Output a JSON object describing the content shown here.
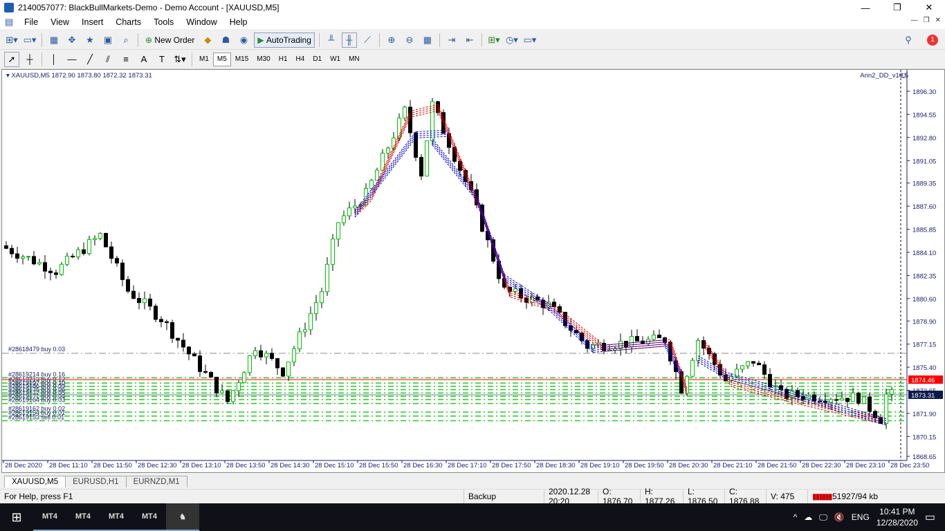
{
  "window": {
    "title": "2140057077: BlackBullMarkets-Demo - Demo Account - [XAUUSD,M5]",
    "minimize": "—",
    "maximize": "❐",
    "close": "✕"
  },
  "menu": [
    "File",
    "View",
    "Insert",
    "Charts",
    "Tools",
    "Window",
    "Help"
  ],
  "toolbar": {
    "new_order": "New Order",
    "autotrading": "AutoTrading",
    "notif_count": "1"
  },
  "timeframes": [
    "M1",
    "M5",
    "M15",
    "M30",
    "H1",
    "H4",
    "D1",
    "W1",
    "MN"
  ],
  "active_timeframe": "M5",
  "chart": {
    "symbol_info": "XAUUSD,M5  1872.90 1873.80 1872.32 1873.31",
    "ea_name": "Arin2_DD_v10.5",
    "price_ticks": [
      "1896.30",
      "1894.55",
      "1892.80",
      "1891.05",
      "1889.35",
      "1887.60",
      "1885.85",
      "1884.10",
      "1882.35",
      "1880.60",
      "1878.90",
      "1877.15",
      "1875.40",
      "1873.65",
      "1871.90",
      "1870.15",
      "1868.65"
    ],
    "price_range": [
      1868.65,
      1896.3
    ],
    "time_labels": [
      "28 Dec 2020",
      "28 Dec 11:10",
      "28 Dec 11:50",
      "28 Dec 12:30",
      "28 Dec 13:10",
      "28 Dec 13:50",
      "28 Dec 14:30",
      "28 Dec 15:10",
      "28 Dec 15:50",
      "28 Dec 16:30",
      "28 Dec 17:10",
      "28 Dec 17:50",
      "28 Dec 18:30",
      "28 Dec 19:10",
      "28 Dec 19:50",
      "28 Dec 20:30",
      "28 Dec 21:10",
      "28 Dec 21:50",
      "28 Dec 22:30",
      "28 Dec 23:10",
      "28 Dec 23:50"
    ],
    "ask_label": "1874.46",
    "bid_label": "1873.31",
    "ask": 1874.46,
    "bid": 1873.31,
    "price_waypoints": [
      [
        0,
        1884.6
      ],
      [
        10,
        1882.7
      ],
      [
        18,
        1885.4
      ],
      [
        23,
        1881.2
      ],
      [
        29,
        1879.1
      ],
      [
        35,
        1875.9
      ],
      [
        41,
        1872.8
      ],
      [
        46,
        1877.0
      ],
      [
        51,
        1875.1
      ],
      [
        58,
        1881.2
      ],
      [
        61,
        1886.4
      ],
      [
        66,
        1888.5
      ],
      [
        73,
        1894.8
      ],
      [
        76,
        1890.1
      ],
      [
        78,
        1895.3
      ],
      [
        85,
        1888.5
      ],
      [
        91,
        1881.2
      ],
      [
        99,
        1880.1
      ],
      [
        106,
        1877.0
      ],
      [
        120,
        1877.5
      ],
      [
        123,
        1873.8
      ],
      [
        126,
        1877.5
      ],
      [
        131,
        1874.4
      ],
      [
        136,
        1875.9
      ],
      [
        141,
        1873.3
      ],
      [
        155,
        1873.1
      ],
      [
        159,
        1871.5
      ],
      [
        160,
        1873.3
      ]
    ],
    "orders": [
      {
        "label": "#28618479 buy 0.03",
        "price": 1876.45
      },
      {
        "label": "#28619214 buy 0.16",
        "price": 1874.6
      },
      {
        "label": "#28619213 buy 0.12",
        "price": 1874.2
      },
      {
        "label": "#28619197 buy 0.10",
        "price": 1873.95
      },
      {
        "label": "#28619186 buy 0.09",
        "price": 1873.7
      },
      {
        "label": "#28619175 buy 0.06",
        "price": 1873.45
      },
      {
        "label": "#28619172 buy 0.05",
        "price": 1873.2
      },
      {
        "label": "#28619171 buy 0.04",
        "price": 1872.95
      },
      {
        "label": "#28619164 buy 0.03",
        "price": 1872.65
      },
      {
        "label": "#28619162 buy 0.02",
        "price": 1872.0
      },
      {
        "label": "#28619154 buy 0.01",
        "price": 1871.7
      },
      {
        "label": "#28619153 sell 0.01",
        "price": 1871.35
      }
    ],
    "colors": {
      "bull": "#00c000",
      "bear": "#000000",
      "ask": "#ff0000",
      "axis": "#1a1a6a",
      "order": "#22cc22"
    }
  },
  "tabs": [
    "XAUUSD,M5",
    "EURUSD,H1",
    "EURNZD,M1"
  ],
  "status": {
    "help": "For Help, press F1",
    "profile": "Backup",
    "time": "2020.12.28 20:20",
    "open": "O: 1876.70",
    "high": "H: 1877.26",
    "low": "L: 1876.50",
    "close": "C: 1876.88",
    "volume": "V: 475",
    "traffic": "51927/94 kb"
  },
  "taskbar": {
    "apps": [
      "MT4",
      "MT4",
      "MT4",
      "MT4"
    ],
    "lang": "ENG",
    "time": "10:41 PM",
    "date": "12/28/2020"
  }
}
